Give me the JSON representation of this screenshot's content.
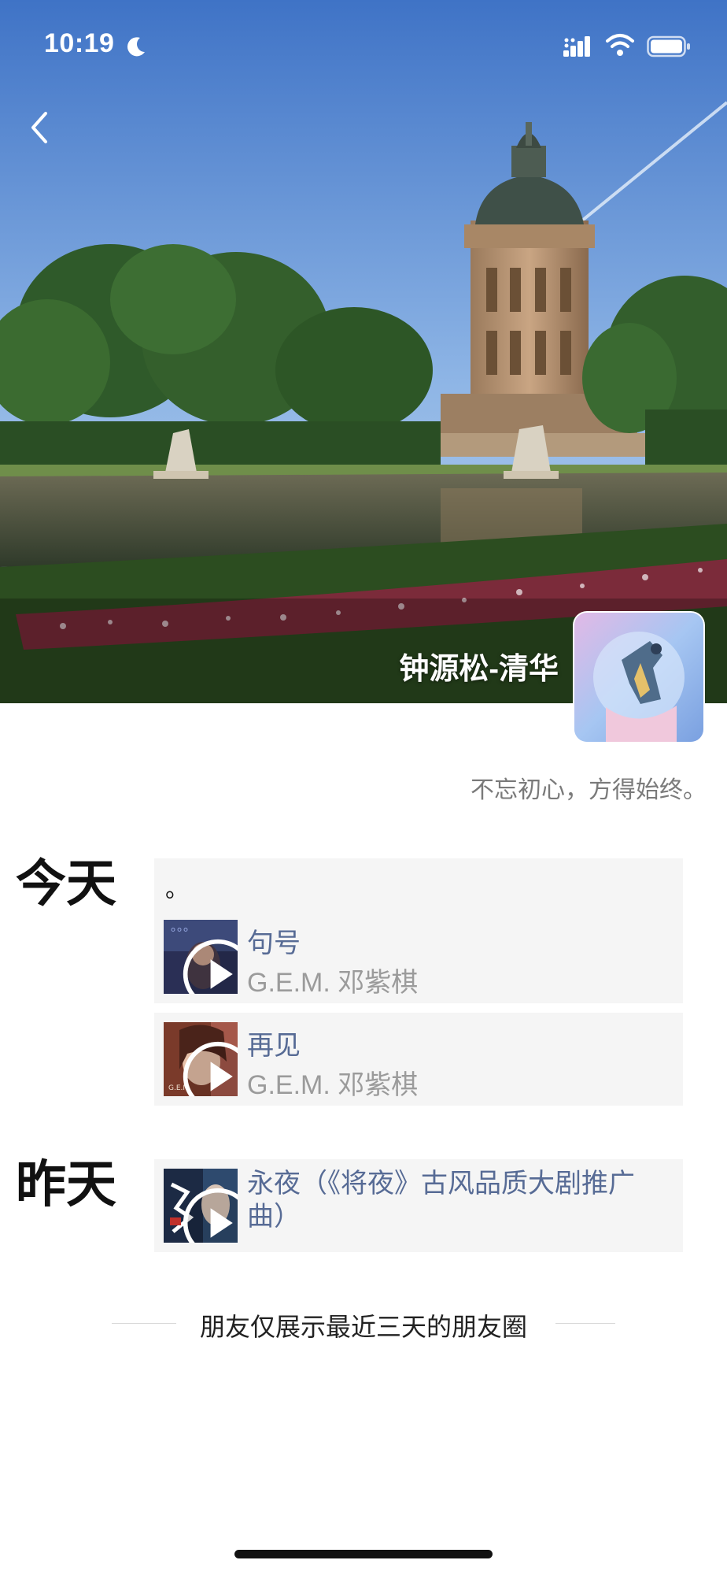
{
  "status_bar": {
    "time": "10:19"
  },
  "profile": {
    "nickname": "钟源松-清华",
    "signature": "不忘初心，方得始终。"
  },
  "feed": [
    {
      "day": "今天",
      "posts": [
        {
          "text": "。",
          "music": {
            "title": "句号",
            "artist": "G.E.M. 邓紫棋"
          }
        },
        {
          "text": "",
          "music": {
            "title": "再见",
            "artist": "G.E.M. 邓紫棋"
          }
        }
      ]
    },
    {
      "day": "昨天",
      "posts": [
        {
          "text": "",
          "music": {
            "title": "永夜（《将夜》古风品质大剧推广曲）",
            "artist": ""
          }
        }
      ]
    }
  ],
  "footer": {
    "text": "朋友仅展示最近三天的朋友圈"
  },
  "colors": {
    "link": "#576b95",
    "secondary": "#9b9b9b",
    "post_bg": "#f5f5f5"
  },
  "icons": [
    "back-arrow-icon",
    "moon-icon",
    "signal-icon",
    "wifi-icon",
    "battery-icon",
    "play-icon"
  ]
}
